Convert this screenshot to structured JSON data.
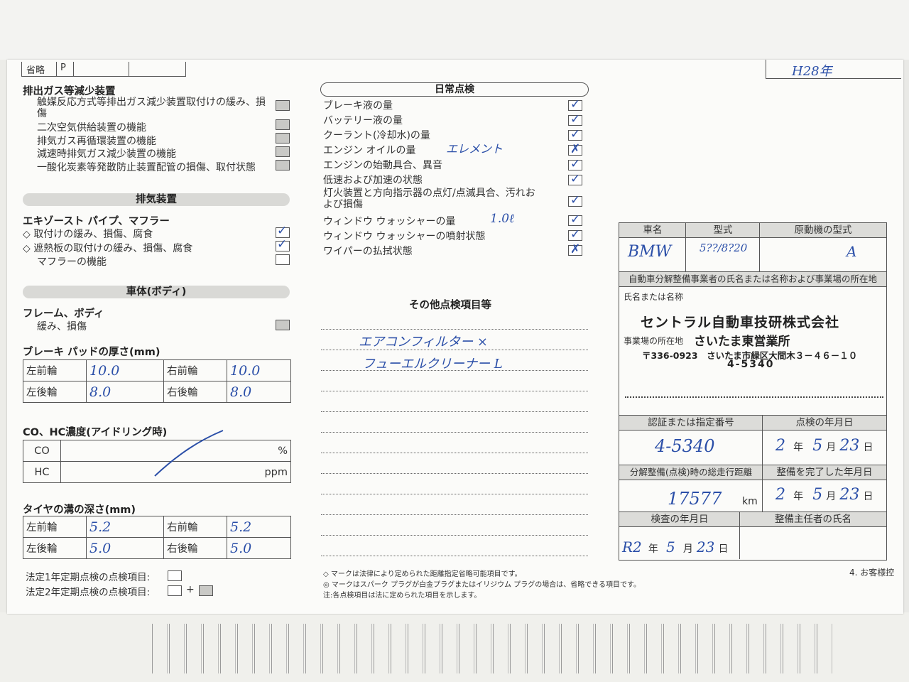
{
  "top_header": {
    "abbrev_label": "省略",
    "abbrev_value": "P",
    "date_note": "H28年"
  },
  "exhaust_gas": {
    "title": "排出ガス等減少装置",
    "items": [
      "触媒反応方式等排出ガス減少装置取付けの緩み、損傷",
      "二次空気供給装置の機能",
      "排気ガス再循環装置の機能",
      "減速時排気ガス減少装置の機能",
      "一酸化炭素等発散防止装置配管の損傷、取付状態"
    ]
  },
  "exhaust_system": {
    "band": "排気装置",
    "title": "エキゾースト パイプ、マフラー",
    "items": [
      {
        "label": "◇ 取付けの緩み、損傷、腐食",
        "checked": true
      },
      {
        "label": "◇ 遮熱板の取付けの緩み、損傷、腐食",
        "checked": true
      },
      {
        "label": "マフラーの機能",
        "checked": false
      }
    ]
  },
  "body_section": {
    "band": "車体(ボディ)",
    "title": "フレーム、ボディ",
    "item": "緩み、損傷"
  },
  "brake_pad": {
    "title": "ブレーキ パッドの厚さ(mm)",
    "rows": [
      {
        "l_label": "左前輪",
        "l_value": "10.0",
        "r_label": "右前輪",
        "r_value": "10.0"
      },
      {
        "l_label": "左後輪",
        "l_value": "8.0",
        "r_label": "右後輪",
        "r_value": "8.0"
      }
    ]
  },
  "co_hc": {
    "title": "CO、HC濃度(アイドリング時)",
    "rows": [
      {
        "label": "CO",
        "unit": "%"
      },
      {
        "label": "HC",
        "unit": "ppm"
      }
    ]
  },
  "tire": {
    "title": "タイヤの溝の深さ(mm)",
    "rows": [
      {
        "l_label": "左前輪",
        "l_value": "5.2",
        "r_label": "右前輪",
        "r_value": "5.2"
      },
      {
        "l_label": "左後輪",
        "l_value": "5.0",
        "r_label": "右後輪",
        "r_value": "5.0"
      }
    ]
  },
  "legend": {
    "one_year": "法定1年定期点検の点検項目:",
    "two_year": "法定2年定期点検の点検項目:",
    "plus": "+"
  },
  "daily": {
    "band": "日常点検",
    "items": [
      {
        "label": "ブレーキ液の量",
        "mark": "✓",
        "note": ""
      },
      {
        "label": "バッテリー液の量",
        "mark": "✓",
        "note": ""
      },
      {
        "label": "クーラント(冷却水)の量",
        "mark": "✓",
        "note": ""
      },
      {
        "label": "エンジン オイルの量",
        "mark": "✗",
        "note": "エレメント"
      },
      {
        "label": "エンジンの始動具合、異音",
        "mark": "✓",
        "note": ""
      },
      {
        "label": "低速および加速の状態",
        "mark": "✓",
        "note": ""
      },
      {
        "label": "灯火装置と方向指示器の点灯/点滅具合、汚れおよび損傷",
        "mark": "✓",
        "note": ""
      },
      {
        "label": "ウィンドウ ウォッシャーの量",
        "mark": "✓",
        "note": "1.0ℓ"
      },
      {
        "label": "ウィンドウ ウォッシャーの噴射状態",
        "mark": "✓",
        "note": ""
      },
      {
        "label": "ワイパーの払拭状態",
        "mark": "✗",
        "note": ""
      }
    ]
  },
  "other": {
    "title": "その他点検項目等",
    "lines": [
      "エアコンフィルター ×",
      "フューエルクリーナー L"
    ]
  },
  "footnotes": [
    "◇ マークは法律により定められた距離指定省略可能項目です。",
    "◎ マークはスパーク プラグが白金プラグまたはイリジウム プラグの場合は、省略できる項目です。",
    "注:各点検項目は法に定められた項目を示します。"
  ],
  "page_note": "4. お客様控",
  "vehicle": {
    "name_label": "車名",
    "model_label": "型式",
    "engine_label": "原動機の型式",
    "name": "BMW",
    "model": "5??/8?20",
    "engine": "A",
    "business_label": "自動車分解整備事業者の氏名または名称および事業場の所在地",
    "name_or_title": "氏名または名称",
    "company": "セントラル自動車技研株式会社",
    "location_label": "事業場の所在地",
    "branch": "さいたま東営業所",
    "address": "〒336-0923　さいたま市緑区大間木３－４６－１０",
    "phone": "4-5340",
    "cert_label": "認証または指定番号",
    "cert_value": "4-5340",
    "inspect_date_label": "点検の年月日",
    "odometer_label": "分解整備(点検)時の総走行距離",
    "odometer_value": "17577",
    "odometer_unit": "km",
    "complete_label": "整備を完了した年月日",
    "check_date_label": "検査の年月日",
    "chief_label": "整備主任者の氏名",
    "date_inspect": {
      "y": "2",
      "m": "5",
      "d": "23"
    },
    "date_complete": {
      "y": "2",
      "m": "5",
      "d": "23"
    },
    "date_check": {
      "era": "R2",
      "m": "5",
      "d": "23"
    },
    "year_char": "年",
    "month_char": "月",
    "day_char": "日"
  }
}
